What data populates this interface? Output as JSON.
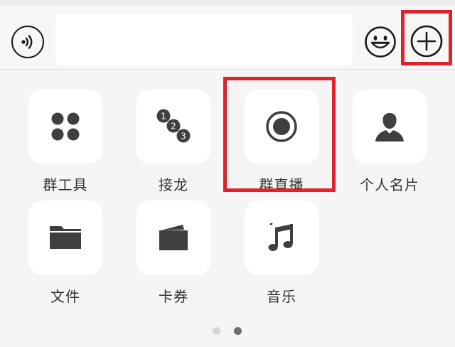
{
  "input_bar": {
    "voice_icon": "voice-wave-icon",
    "text_value": "",
    "emoji_icon": "smiley-face-icon",
    "plus_icon": "plus-circle-icon"
  },
  "panel": {
    "items": [
      {
        "label": "群工具",
        "icon": "four-dots-grid-icon"
      },
      {
        "label": "接龙",
        "icon": "numbered-chain-icon"
      },
      {
        "label": "群直播",
        "icon": "record-circle-icon"
      },
      {
        "label": "个人名片",
        "icon": "person-icon"
      },
      {
        "label": "文件",
        "icon": "folder-icon"
      },
      {
        "label": "卡券",
        "icon": "wallet-card-icon"
      },
      {
        "label": "音乐",
        "icon": "music-note-icon"
      }
    ],
    "chain_numbers": [
      "1",
      "2",
      "3"
    ]
  },
  "pagination": {
    "total": 2,
    "active": 2
  },
  "colors": {
    "highlight": "#e0232a",
    "icon": "#3f3f3f",
    "tile": "#ffffff",
    "background": "#f5f5f5"
  }
}
